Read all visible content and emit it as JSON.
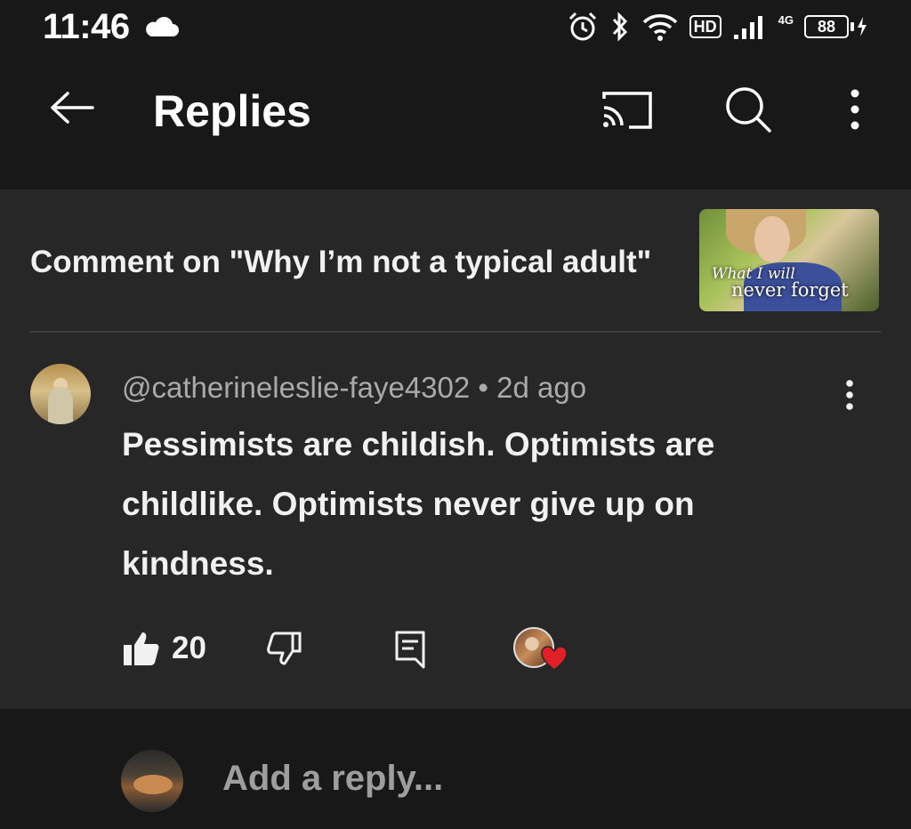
{
  "status_bar": {
    "time": "11:46",
    "hd_label": "HD",
    "network_label": "4G",
    "battery_level": "88"
  },
  "app_bar": {
    "title": "Replies",
    "icons": [
      "back-arrow-icon",
      "cast-icon",
      "search-icon",
      "more-vert-icon"
    ]
  },
  "comment_context": {
    "title": "Comment on \"Why I’m not a typical adult\"",
    "thumbnail_text_line1": "What I will",
    "thumbnail_text_line2": "never forget"
  },
  "comment": {
    "author": "@catherineleslie-faye4302",
    "separator": "•",
    "age": "2d ago",
    "text": "Pessimists are childish. Optimists are childlike. Optimists never give up on kindness.",
    "like_count": "20"
  },
  "reply_box": {
    "placeholder": "Add a reply..."
  },
  "colors": {
    "background": "#181818",
    "card": "#272727",
    "text_primary": "#f1f1f1",
    "text_secondary": "#aaaaaa",
    "heart": "#e41e26"
  }
}
